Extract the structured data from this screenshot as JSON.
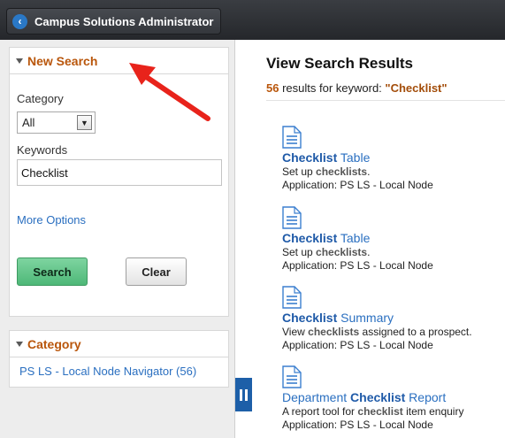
{
  "header": {
    "back_label": "Campus Solutions Administrator"
  },
  "search_panel": {
    "title": "New Search",
    "category_label": "Category",
    "category_value": "All",
    "keywords_label": "Keywords",
    "keywords_value": "Checklist",
    "more_options": "More Options",
    "search_button": "Search",
    "clear_button": "Clear"
  },
  "category_panel": {
    "title": "Category",
    "item": "PS LS - Local Node Navigator (56)"
  },
  "results": {
    "title": "View Search Results",
    "count": "56",
    "summary_text": " results for keyword: ",
    "keyword": "\"Checklist\"",
    "items": [
      {
        "title_bold": "Checklist",
        "title_rest": " Table",
        "desc_pre": "Set up ",
        "desc_bold": "checklists",
        "desc_post": ".",
        "app": "Application: PS LS - Local Node"
      },
      {
        "title_bold": "Checklist",
        "title_rest": " Table",
        "desc_pre": "Set up ",
        "desc_bold": "checklists",
        "desc_post": ".",
        "app": "Application: PS LS - Local Node"
      },
      {
        "title_bold": "Checklist",
        "title_rest": " Summary",
        "desc_pre": "View ",
        "desc_bold": "checklists",
        "desc_post": " assigned to a prospect.",
        "app": "Application: PS LS - Local Node"
      },
      {
        "title_pre": "Department ",
        "title_bold": "Checklist",
        "title_rest": " Report",
        "desc_pre": "A report tool for ",
        "desc_bold": "checklist",
        "desc_post": " item enquiry",
        "app": "Application: PS LS - Local Node"
      }
    ]
  },
  "colors": {
    "accent_orange": "#b9560b",
    "link_blue": "#2a6fc0",
    "search_green": "#5cc285",
    "annotation_red": "#e8231b"
  },
  "icons": [
    "back-arrow-icon",
    "collapse-triangle-icon",
    "dropdown-arrow-icon",
    "document-icon",
    "collapse-panel-icon",
    "annotation-arrow-icon"
  ]
}
